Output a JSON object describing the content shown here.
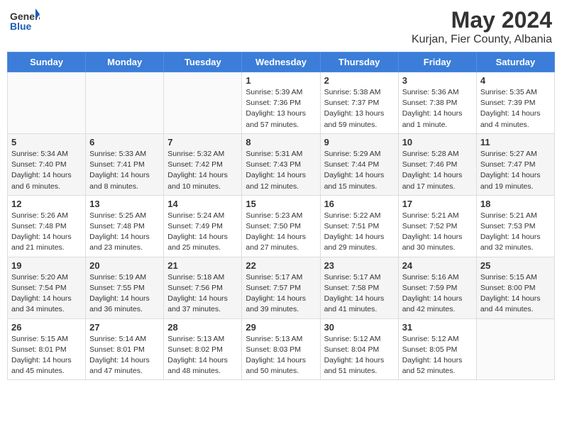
{
  "header": {
    "logo_general": "General",
    "logo_blue": "Blue",
    "title": "May 2024",
    "subtitle": "Kurjan, Fier County, Albania"
  },
  "weekdays": [
    "Sunday",
    "Monday",
    "Tuesday",
    "Wednesday",
    "Thursday",
    "Friday",
    "Saturday"
  ],
  "weeks": [
    [
      {
        "day": "",
        "info": ""
      },
      {
        "day": "",
        "info": ""
      },
      {
        "day": "",
        "info": ""
      },
      {
        "day": "1",
        "info": "Sunrise: 5:39 AM\nSunset: 7:36 PM\nDaylight: 13 hours\nand 57 minutes."
      },
      {
        "day": "2",
        "info": "Sunrise: 5:38 AM\nSunset: 7:37 PM\nDaylight: 13 hours\nand 59 minutes."
      },
      {
        "day": "3",
        "info": "Sunrise: 5:36 AM\nSunset: 7:38 PM\nDaylight: 14 hours\nand 1 minute."
      },
      {
        "day": "4",
        "info": "Sunrise: 5:35 AM\nSunset: 7:39 PM\nDaylight: 14 hours\nand 4 minutes."
      }
    ],
    [
      {
        "day": "5",
        "info": "Sunrise: 5:34 AM\nSunset: 7:40 PM\nDaylight: 14 hours\nand 6 minutes."
      },
      {
        "day": "6",
        "info": "Sunrise: 5:33 AM\nSunset: 7:41 PM\nDaylight: 14 hours\nand 8 minutes."
      },
      {
        "day": "7",
        "info": "Sunrise: 5:32 AM\nSunset: 7:42 PM\nDaylight: 14 hours\nand 10 minutes."
      },
      {
        "day": "8",
        "info": "Sunrise: 5:31 AM\nSunset: 7:43 PM\nDaylight: 14 hours\nand 12 minutes."
      },
      {
        "day": "9",
        "info": "Sunrise: 5:29 AM\nSunset: 7:44 PM\nDaylight: 14 hours\nand 15 minutes."
      },
      {
        "day": "10",
        "info": "Sunrise: 5:28 AM\nSunset: 7:46 PM\nDaylight: 14 hours\nand 17 minutes."
      },
      {
        "day": "11",
        "info": "Sunrise: 5:27 AM\nSunset: 7:47 PM\nDaylight: 14 hours\nand 19 minutes."
      }
    ],
    [
      {
        "day": "12",
        "info": "Sunrise: 5:26 AM\nSunset: 7:48 PM\nDaylight: 14 hours\nand 21 minutes."
      },
      {
        "day": "13",
        "info": "Sunrise: 5:25 AM\nSunset: 7:48 PM\nDaylight: 14 hours\nand 23 minutes."
      },
      {
        "day": "14",
        "info": "Sunrise: 5:24 AM\nSunset: 7:49 PM\nDaylight: 14 hours\nand 25 minutes."
      },
      {
        "day": "15",
        "info": "Sunrise: 5:23 AM\nSunset: 7:50 PM\nDaylight: 14 hours\nand 27 minutes."
      },
      {
        "day": "16",
        "info": "Sunrise: 5:22 AM\nSunset: 7:51 PM\nDaylight: 14 hours\nand 29 minutes."
      },
      {
        "day": "17",
        "info": "Sunrise: 5:21 AM\nSunset: 7:52 PM\nDaylight: 14 hours\nand 30 minutes."
      },
      {
        "day": "18",
        "info": "Sunrise: 5:21 AM\nSunset: 7:53 PM\nDaylight: 14 hours\nand 32 minutes."
      }
    ],
    [
      {
        "day": "19",
        "info": "Sunrise: 5:20 AM\nSunset: 7:54 PM\nDaylight: 14 hours\nand 34 minutes."
      },
      {
        "day": "20",
        "info": "Sunrise: 5:19 AM\nSunset: 7:55 PM\nDaylight: 14 hours\nand 36 minutes."
      },
      {
        "day": "21",
        "info": "Sunrise: 5:18 AM\nSunset: 7:56 PM\nDaylight: 14 hours\nand 37 minutes."
      },
      {
        "day": "22",
        "info": "Sunrise: 5:17 AM\nSunset: 7:57 PM\nDaylight: 14 hours\nand 39 minutes."
      },
      {
        "day": "23",
        "info": "Sunrise: 5:17 AM\nSunset: 7:58 PM\nDaylight: 14 hours\nand 41 minutes."
      },
      {
        "day": "24",
        "info": "Sunrise: 5:16 AM\nSunset: 7:59 PM\nDaylight: 14 hours\nand 42 minutes."
      },
      {
        "day": "25",
        "info": "Sunrise: 5:15 AM\nSunset: 8:00 PM\nDaylight: 14 hours\nand 44 minutes."
      }
    ],
    [
      {
        "day": "26",
        "info": "Sunrise: 5:15 AM\nSunset: 8:01 PM\nDaylight: 14 hours\nand 45 minutes."
      },
      {
        "day": "27",
        "info": "Sunrise: 5:14 AM\nSunset: 8:01 PM\nDaylight: 14 hours\nand 47 minutes."
      },
      {
        "day": "28",
        "info": "Sunrise: 5:13 AM\nSunset: 8:02 PM\nDaylight: 14 hours\nand 48 minutes."
      },
      {
        "day": "29",
        "info": "Sunrise: 5:13 AM\nSunset: 8:03 PM\nDaylight: 14 hours\nand 50 minutes."
      },
      {
        "day": "30",
        "info": "Sunrise: 5:12 AM\nSunset: 8:04 PM\nDaylight: 14 hours\nand 51 minutes."
      },
      {
        "day": "31",
        "info": "Sunrise: 5:12 AM\nSunset: 8:05 PM\nDaylight: 14 hours\nand 52 minutes."
      },
      {
        "day": "",
        "info": ""
      }
    ]
  ]
}
